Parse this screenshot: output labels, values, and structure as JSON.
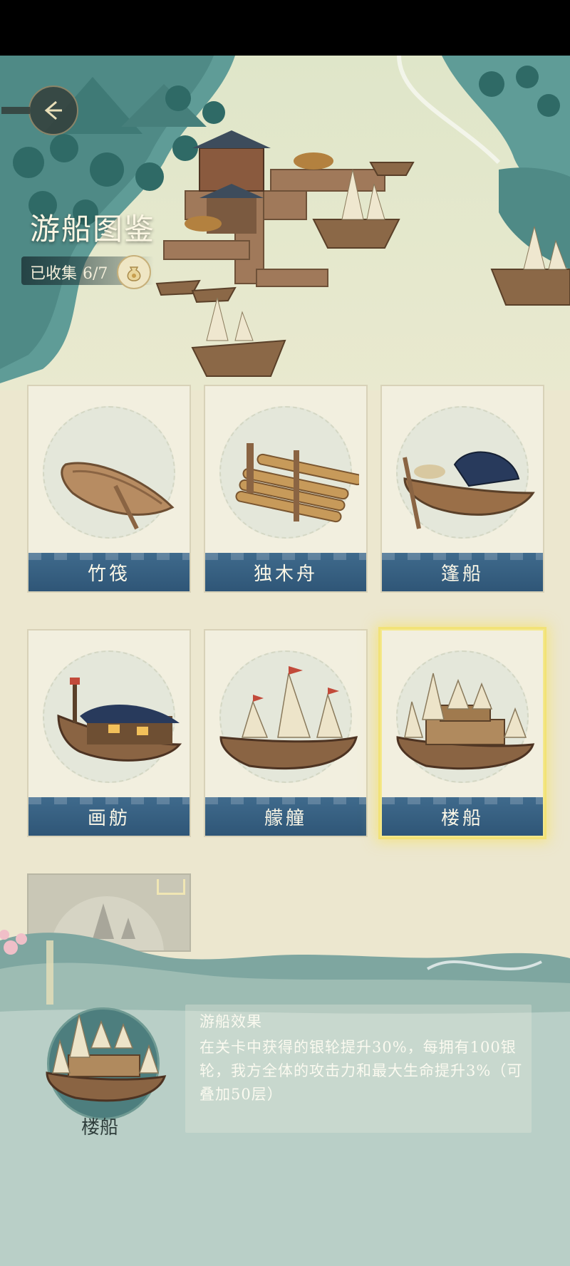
{
  "header": {
    "title": "游船图鉴",
    "collected_label": "已收集",
    "collected_count": "6/7"
  },
  "boats": [
    {
      "name": "竹筏",
      "icon": "rowboat-icon"
    },
    {
      "name": "独木舟",
      "icon": "raft-icon"
    },
    {
      "name": "篷船",
      "icon": "canopy-boat-icon"
    },
    {
      "name": "画舫",
      "icon": "painted-barge-icon"
    },
    {
      "name": "艨艟",
      "icon": "warship-icon"
    },
    {
      "name": "楼船",
      "icon": "tower-ship-icon"
    }
  ],
  "selected_boat": {
    "name": "楼船",
    "effect_title": "游船效果",
    "effect_text": "在关卡中获得的银轮提升30%，每拥有100银轮，我方全体的攻击力和最大生命提升3%（可叠加50层）"
  },
  "colors": {
    "label_band": "#2f5677",
    "selected_glow": "#f2e276",
    "water_teal": "#5f9c97"
  }
}
